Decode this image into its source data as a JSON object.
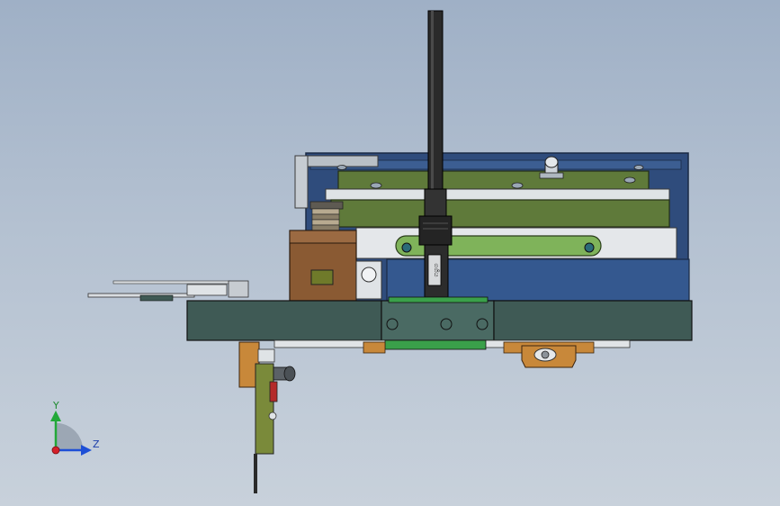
{
  "viewport": {
    "background_top": "#9fb0c6",
    "background_bottom": "#c8d1db"
  },
  "triad": {
    "y_label": "Y",
    "z_label": "Z",
    "x_color": "#d4202a",
    "y_color": "#22a838",
    "z_color": "#1d4fd6"
  },
  "model": {
    "cable_label": "ගගිය",
    "colors": {
      "dark_slate": "#3f5a55",
      "navy": "#2f4c7c",
      "olive": "#5f7a3a",
      "light_green": "#7fb35a",
      "brown": "#8a5a33",
      "orange": "#c8883a",
      "cable": "#2a2a2a",
      "silver": "#cdd3da"
    }
  }
}
